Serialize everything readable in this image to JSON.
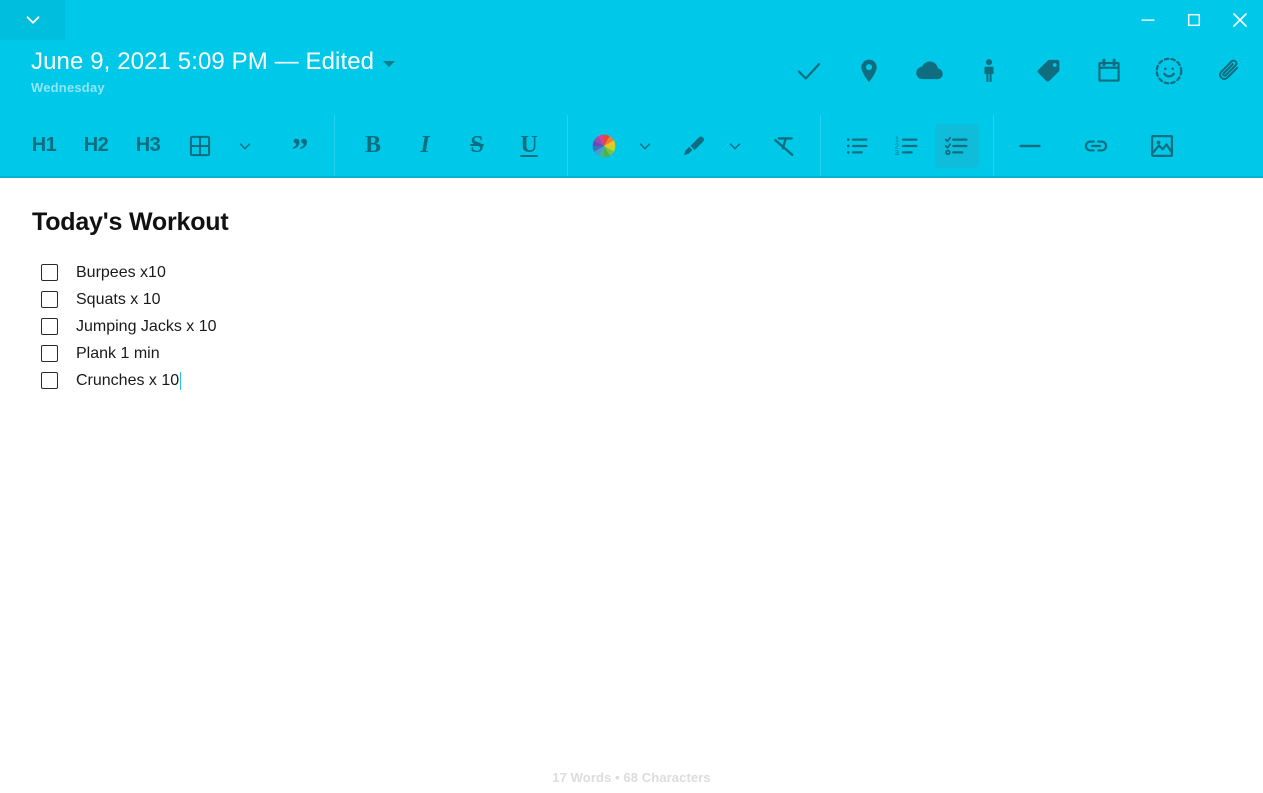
{
  "window": {
    "accent_color": "#00c8e8",
    "icon_color": "#0e6e80",
    "collapse_icon": "chevron-down-icon",
    "controls": {
      "minimize": "minimize-icon",
      "maximize": "maximize-icon",
      "close": "close-icon"
    }
  },
  "note_header": {
    "title": "June 9, 2021 5:09 PM — Edited",
    "weekday": "Wednesday",
    "dropdown_icon": "caret-down-icon",
    "actions": [
      {
        "name": "checklist-toggle",
        "icon": "check-icon",
        "label": "Check"
      },
      {
        "name": "location",
        "icon": "location-pin-icon",
        "label": "Location"
      },
      {
        "name": "sync",
        "icon": "cloud-icon",
        "label": "Cloud Sync"
      },
      {
        "name": "person",
        "icon": "person-icon",
        "label": "People"
      },
      {
        "name": "tags",
        "icon": "tag-icon",
        "label": "Tags"
      },
      {
        "name": "calendar",
        "icon": "calendar-icon",
        "label": "Calendar"
      },
      {
        "name": "sticker",
        "icon": "smiley-icon",
        "label": "Sticker"
      },
      {
        "name": "attach",
        "icon": "paperclip-icon",
        "label": "Attach"
      }
    ]
  },
  "toolbar": {
    "groups": [
      {
        "name": "block-styles",
        "items": [
          {
            "name": "heading-1-button",
            "kind": "text",
            "label": "H1",
            "active": false
          },
          {
            "name": "heading-2-button",
            "kind": "text",
            "label": "H2",
            "active": false
          },
          {
            "name": "heading-3-button",
            "kind": "text",
            "label": "H3",
            "active": false
          },
          {
            "name": "table-button",
            "kind": "icon",
            "icon": "table-grid-icon",
            "label": "Table",
            "active": false
          },
          {
            "name": "table-options-button",
            "kind": "chevron",
            "icon": "chevron-down-icon",
            "label": "Table options",
            "active": false
          },
          {
            "name": "blockquote-button",
            "kind": "quote",
            "label": "”",
            "active": false
          }
        ]
      },
      {
        "name": "character-styles",
        "items": [
          {
            "name": "bold-button",
            "kind": "bold",
            "label": "B",
            "active": false
          },
          {
            "name": "italic-button",
            "kind": "italic",
            "label": "I",
            "active": false
          },
          {
            "name": "strikethrough-button",
            "kind": "strike",
            "label": "S",
            "active": false
          },
          {
            "name": "underline-button",
            "kind": "underline",
            "label": "U",
            "active": false
          }
        ]
      },
      {
        "name": "color-styles",
        "items": [
          {
            "name": "text-color-button",
            "kind": "icon",
            "icon": "color-wheel-icon",
            "label": "Text color",
            "active": false
          },
          {
            "name": "text-color-options-button",
            "kind": "chevron",
            "icon": "chevron-down-icon",
            "label": "Text color options",
            "active": false
          },
          {
            "name": "highlight-button",
            "kind": "icon",
            "icon": "highlighter-icon",
            "label": "Highlight",
            "active": false
          },
          {
            "name": "highlight-options-button",
            "kind": "chevron",
            "icon": "chevron-down-icon",
            "label": "Highlight options",
            "active": false
          },
          {
            "name": "clear-formatting-button",
            "kind": "icon",
            "icon": "clear-formatting-icon",
            "label": "Clear formatting",
            "active": false
          }
        ]
      },
      {
        "name": "lists",
        "items": [
          {
            "name": "bulleted-list-button",
            "kind": "icon",
            "icon": "bulleted-list-icon",
            "label": "Bulleted list",
            "active": false
          },
          {
            "name": "numbered-list-button",
            "kind": "icon",
            "icon": "numbered-list-icon",
            "label": "Numbered list",
            "active": false
          },
          {
            "name": "checklist-button",
            "kind": "icon",
            "icon": "checklist-icon",
            "label": "Checklist",
            "active": true
          }
        ]
      },
      {
        "name": "insert",
        "items": [
          {
            "name": "horizontal-rule-button",
            "kind": "icon",
            "icon": "horizontal-rule-icon",
            "label": "Horizontal rule",
            "active": false
          },
          {
            "name": "link-button",
            "kind": "icon",
            "icon": "link-icon",
            "label": "Link",
            "active": false
          },
          {
            "name": "image-button",
            "kind": "icon",
            "icon": "image-icon",
            "label": "Image",
            "active": false
          }
        ]
      }
    ]
  },
  "document": {
    "heading": "Today's Workout",
    "checklist": [
      {
        "label": "Burpees x10",
        "checked": false,
        "caret": false
      },
      {
        "label": "Squats x 10",
        "checked": false,
        "caret": false
      },
      {
        "label": "Jumping Jacks x 10",
        "checked": false,
        "caret": false
      },
      {
        "label": "Plank 1 min",
        "checked": false,
        "caret": false
      },
      {
        "label": "Crunches x 10",
        "checked": false,
        "caret": true
      }
    ]
  },
  "status": {
    "word_count": "17 Words • 68 Characters"
  }
}
